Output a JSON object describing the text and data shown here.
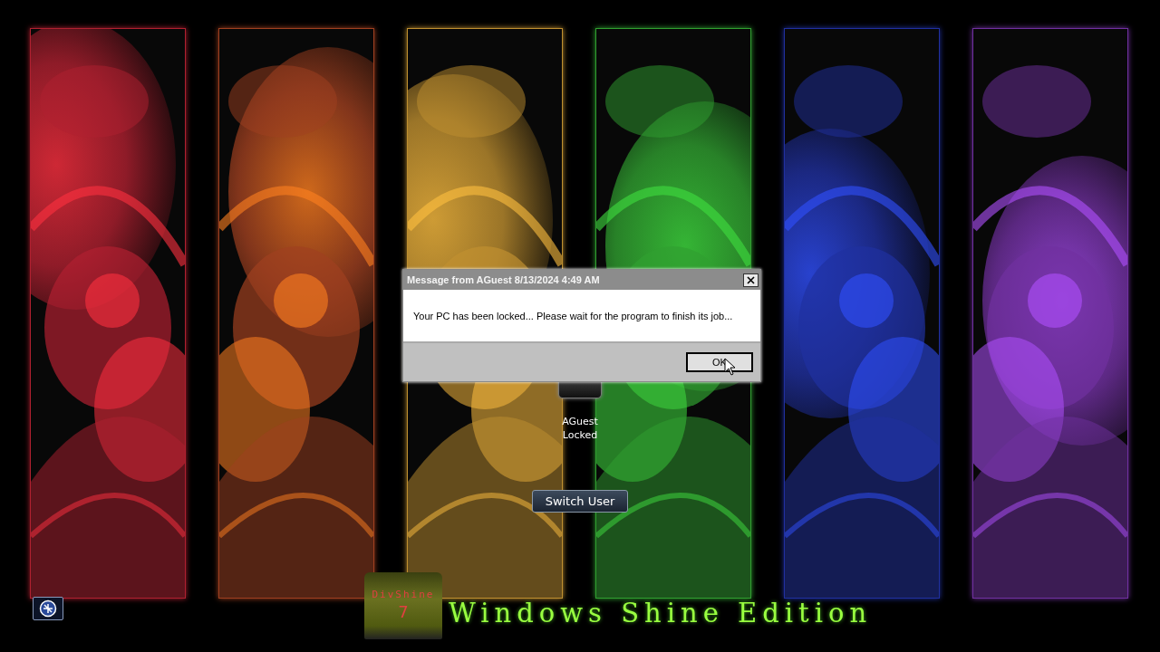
{
  "dialog": {
    "title": "Message from AGuest 8/13/2024 4:49 AM",
    "message": "Your PC has been locked... Please wait for the program to finish its job...",
    "buttons": [
      "OK"
    ]
  },
  "user": {
    "name": "AGuest",
    "status": "Locked"
  },
  "switch_button": "Switch User",
  "logo": {
    "name": "DivShine",
    "version": "7",
    "edition": "Windows Shine Edition"
  }
}
